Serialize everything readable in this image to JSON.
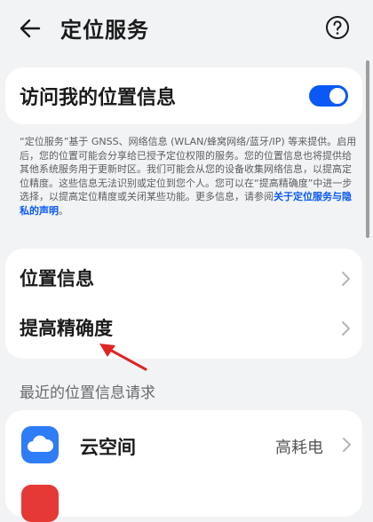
{
  "header": {
    "title": "定位服务"
  },
  "location_toggle": {
    "label": "访问我的位置信息",
    "enabled": true
  },
  "description": {
    "text": "“定位服务”基于 GNSS、网络信息 (WLAN/蜂窝网络/蓝牙/IP) 等来提供。启用后，您的位置可能会分享给已授予定位权限的服务。您的位置信息也将提供给其他系统服务用于更新时区。我们可能会从您的设备收集网络信息，以提高定位精度。这些信息无法识别或定位到您个人。您可以在“提高精确度”中进一步选择，以提高定位精度或关闭某些功能。更多信息，请参阅",
    "link": "关于定位服务与隐私的声明",
    "suffix": "。"
  },
  "settings": [
    {
      "label": "位置信息"
    },
    {
      "label": "提高精确度"
    }
  ],
  "recent": {
    "section_title": "最近的位置信息请求",
    "apps": [
      {
        "name": "云空间",
        "status": "高耗电"
      }
    ]
  },
  "colors": {
    "accent": "#0a59f7",
    "background": "#f1f3f5",
    "arrow": "#e02424"
  }
}
